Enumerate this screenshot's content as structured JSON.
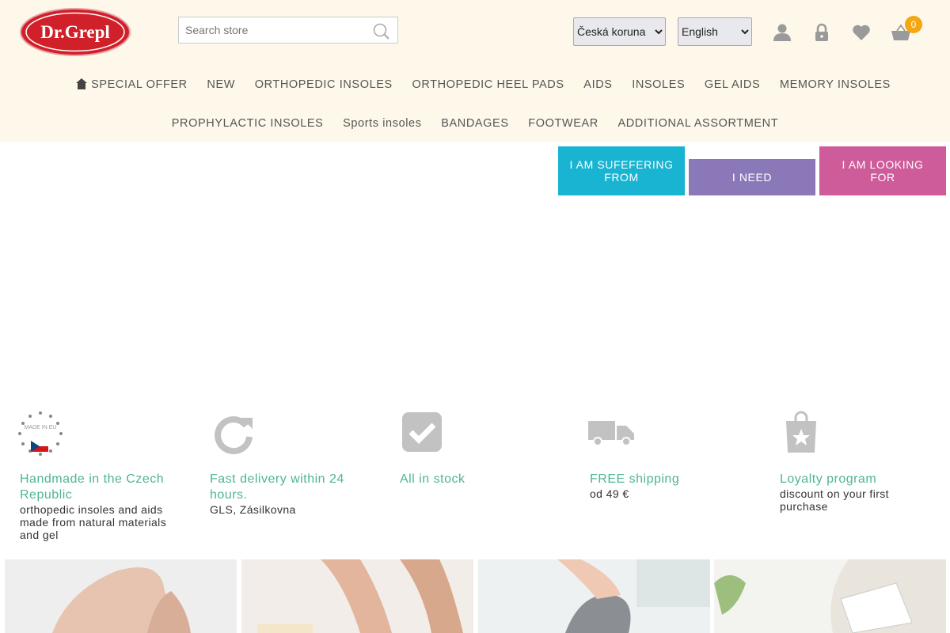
{
  "header": {
    "logo_text": "Dr.Grepl",
    "search": {
      "placeholder": "Search store"
    },
    "currency": {
      "selected": "Česká koruna"
    },
    "language": {
      "selected": "English"
    },
    "cart_count": "0",
    "icons": [
      "user-icon",
      "lock-icon",
      "heart-icon",
      "basket-icon"
    ]
  },
  "nav": {
    "row1": [
      "SPECIAL OFFER",
      "NEW",
      "ORTHOPEDIC INSOLES",
      "ORTHOPEDIC HEEL PADS",
      "AIDS",
      "INSOLES",
      "GEL AIDS",
      "MEMORY INSOLES"
    ],
    "row2": [
      "PROPHYLACTIC INSOLES",
      "Sports insoles",
      "BANDAGES",
      "FOOTWEAR",
      "ADDITIONAL ASSORTMENT"
    ]
  },
  "cta": [
    {
      "label": "I AM SUFEFERING FROM",
      "color": "#19b4d1"
    },
    {
      "label": "I NEED",
      "color": "#8b78b9"
    },
    {
      "label": "I AM LOOKING FOR",
      "color": "#cf5c9a"
    }
  ],
  "features": [
    {
      "icon": "made-in-eu-icon",
      "badge": "MADE IN EU",
      "title": "Handmade in the Czech Republic",
      "subtitle": "orthopedic insoles and aids made from natural materials and gel"
    },
    {
      "icon": "refresh-icon",
      "title": "Fast delivery within 24 hours.",
      "subtitle": "GLS, Zásilkovna"
    },
    {
      "icon": "check-icon",
      "title": "All in stock",
      "subtitle": ""
    },
    {
      "icon": "truck-icon",
      "title": "FREE shipping",
      "subtitle": "od 49 €"
    },
    {
      "icon": "shopping-bag-star-icon",
      "title": "Loyalty program",
      "subtitle": "discount on your first purchase"
    }
  ],
  "colors": {
    "accent_green": "#4fb593",
    "topbar_bg": "#fdf8ea",
    "badge": "#f3a712",
    "logo_red": "#d0202a"
  }
}
